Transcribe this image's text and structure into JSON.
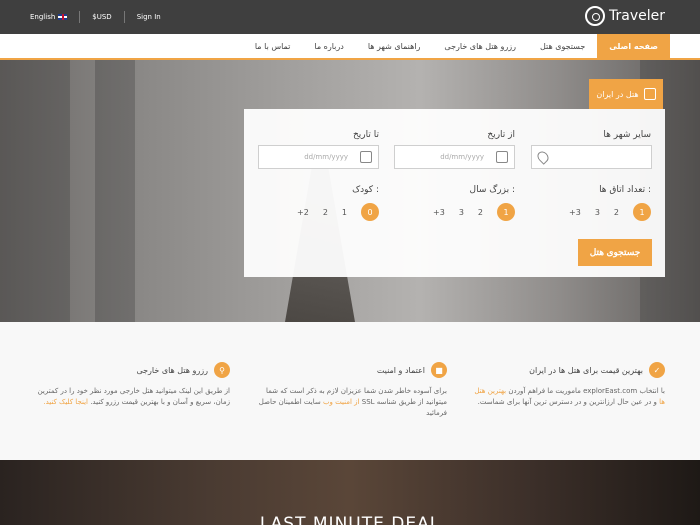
{
  "topbar": {
    "language": "English",
    "currency": "$USD",
    "signin": "Sign In",
    "logo_text": "Traveler"
  },
  "nav": {
    "items": [
      {
        "label": "صفحه اصلی"
      },
      {
        "label": "جستجوی هتل"
      },
      {
        "label": "رزرو هتل های خارجی"
      },
      {
        "label": "راهنمای شهر ها"
      },
      {
        "label": "درباره ما"
      },
      {
        "label": "تماس با ما"
      }
    ]
  },
  "search": {
    "tab_label": "هتل در ایران",
    "city_label": "سایر شهر ها",
    "from_label": "از تاریخ",
    "to_label": "تا تاریخ",
    "date_placeholder": "dd/mm/yyyy",
    "rooms_label": "تعداد اتاق ها :",
    "adults_label": "بزرگ سال :",
    "children_label": "کودک :",
    "rooms_options": [
      "1",
      "2",
      "3",
      "+3"
    ],
    "adults_options": [
      "1",
      "2",
      "3",
      "+3"
    ],
    "children_options": [
      "0",
      "1",
      "2",
      "+2"
    ],
    "submit": "جستجوی هتل"
  },
  "features": [
    {
      "title": "بهترین قیمت برای هتل ها در ایران",
      "desc_pre": "با انتخاب explorEast.com ماموریت ما فراهم آوردن ",
      "desc_hl": "بهترین هتل ها",
      "desc_post": " و در عین حال ارزانترین و در دسترس ترین آنها برای شماست."
    },
    {
      "title": "اعتماد و امنیت",
      "desc_pre": "برای آسوده خاطر شدن شما عزیزان لازم به ذکر است که شما میتوانید از طریق شناسه SSL ",
      "desc_hl": "از امنیت وب",
      "desc_post": " سایت اطمینان حاصل فرمائید"
    },
    {
      "title": "رزرو هتل های خارجی",
      "desc_pre": "از طریق این لینک میتوانید هتل خارجی مورد نظر خود را در کمترین زمان، سریع و آسان و با بهترین قیمت رزرو کنید. ",
      "desc_hl": "اینجا کلیک کنید.",
      "desc_post": ""
    }
  ],
  "bottom": {
    "title": "LAST MINUTE DEAL"
  },
  "colors": {
    "accent": "#f0a445",
    "topbar": "#3f3f3f"
  }
}
